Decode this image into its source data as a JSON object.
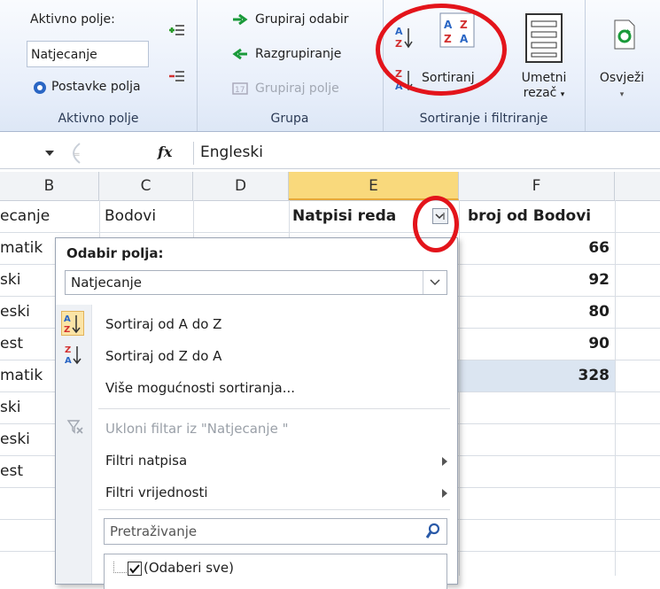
{
  "ribbon": {
    "active_field": {
      "label": "Aktivno polje:",
      "value": "Natjecanje",
      "settings": "Postavke polja",
      "group_label": "Aktivno polje"
    },
    "group": {
      "group_selection": "Grupiraj odabir",
      "ungroup": "Razgrupiranje",
      "group_field": "Grupiraj polje",
      "group_label": "Grupa"
    },
    "sort": {
      "sort_label": "Sortiranj",
      "group_label": "Sortiranje i filtriranje"
    },
    "slicer": {
      "line1": "Umetni",
      "line2": "rezač"
    },
    "refresh": {
      "label": "Osvježi"
    }
  },
  "formula_bar": {
    "fx": "fx",
    "value": "Engleski"
  },
  "columns": [
    "B",
    "C",
    "D",
    "E",
    "F"
  ],
  "grid": {
    "b_header": "ecanje",
    "c_header": "Bodovi",
    "e_header": "Natpisi reda",
    "f_header": "broj od Bodovi",
    "col_b": [
      "matik",
      "ski",
      "eski",
      "est",
      "matik",
      "ski",
      "eski",
      "est"
    ],
    "f_values": [
      "66",
      "92",
      "80",
      "90",
      "328"
    ]
  },
  "dropdown": {
    "title": "Odabir polja:",
    "field_select": "Natjecanje",
    "sort_az": "Sortiraj od A do Z",
    "sort_za": "Sortiraj od Z do A",
    "more_sort": "Više mogućnosti sortiranja...",
    "clear_filter": "Ukloni filtar iz \"Natjecanje \"",
    "label_filters": "Filtri natpisa",
    "value_filters": "Filtri vrijednosti",
    "search_placeholder": "Pretraživanje",
    "select_all": "(Odaberi sve)"
  },
  "colors": {
    "highlight": "#e3141b",
    "selected_header": "#f9d97c",
    "ribbon": "#e7eefa"
  }
}
